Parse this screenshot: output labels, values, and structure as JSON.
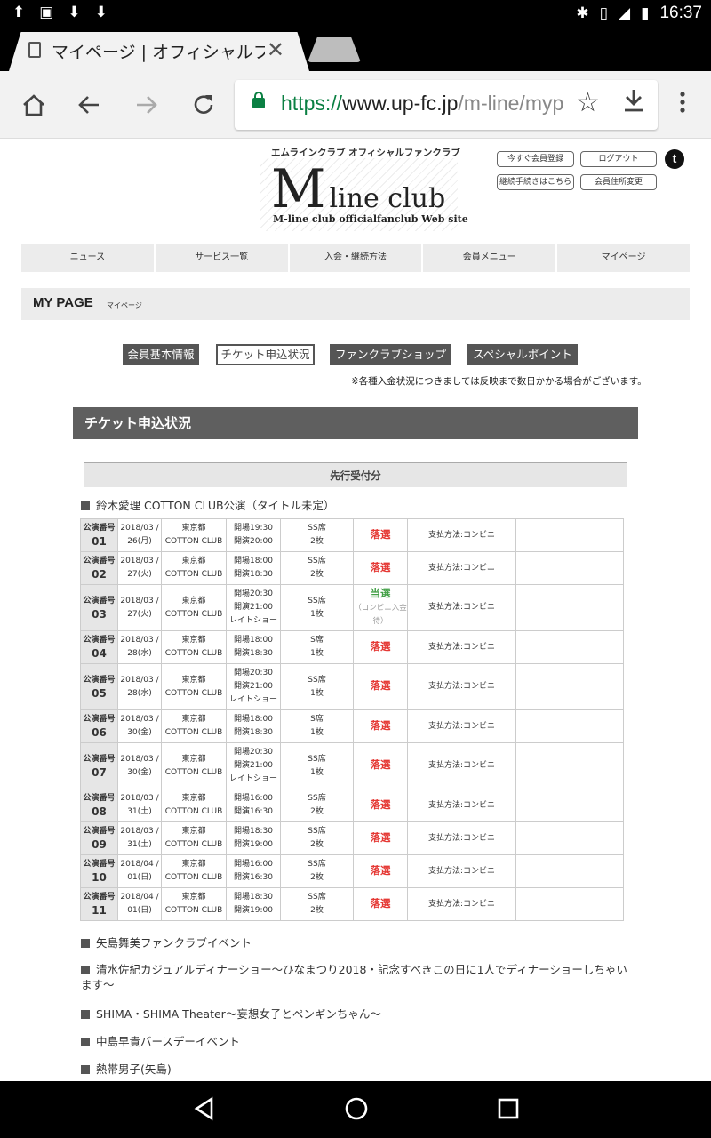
{
  "status_bar": {
    "time": "16:37"
  },
  "browser": {
    "tab_title": "マイページ | オフィシャルファ",
    "url_scheme": "https://",
    "url_host": "www.up-fc.jp",
    "url_path": "/m-line/mypa"
  },
  "header": {
    "logo_subtitle": "エムラインクラブ オフィシャルファンクラブ",
    "logo_big": "M",
    "logo_small": "line club",
    "logo_tagline": "M-line club officialfanclub Web site",
    "buttons": [
      "今すぐ会員登録",
      "ログアウト",
      "継続手続きはこちら",
      "会員住所変更"
    ],
    "twitter_glyph": "t"
  },
  "nav": [
    "ニュース",
    "サービス一覧",
    "入会・継続方法",
    "会員メニュー",
    "マイページ"
  ],
  "mypage": {
    "title_en": "MY PAGE",
    "title_jp": "マイページ"
  },
  "subnav": [
    "会員基本情報",
    "チケット申込状況",
    "ファンクラブショップ",
    "スペシャルポイント"
  ],
  "note": "※各種入金状況につきましては反映まで数日かかる場合がございます。",
  "section_title": "チケット申込状況",
  "phase_label": "先行受付分",
  "main_event": "鈴木愛理 COTTON CLUB公演（タイトル未定）",
  "rows": [
    {
      "label": "公演番号",
      "num": "01",
      "date1": "2018/03 /",
      "date2": "26(月)",
      "pref": "東京都",
      "venue": "COTTON CLUB",
      "open": "開場19:30",
      "start": "開演20:00",
      "extra": "",
      "seat": "SS席",
      "qty": "2枚",
      "result": "落選",
      "result_note": "",
      "pay": "支払方法:コンビニ"
    },
    {
      "label": "公演番号",
      "num": "02",
      "date1": "2018/03 /",
      "date2": "27(火)",
      "pref": "東京都",
      "venue": "COTTON CLUB",
      "open": "開場18:00",
      "start": "開演18:30",
      "extra": "",
      "seat": "SS席",
      "qty": "2枚",
      "result": "落選",
      "result_note": "",
      "pay": "支払方法:コンビニ"
    },
    {
      "label": "公演番号",
      "num": "03",
      "date1": "2018/03 /",
      "date2": "27(火)",
      "pref": "東京都",
      "venue": "COTTON CLUB",
      "open": "開場20:30",
      "start": "開演21:00",
      "extra": "レイトショー",
      "seat": "SS席",
      "qty": "1枚",
      "result": "当選",
      "result_note": "（コンビニ入金待）",
      "pay": "支払方法:コンビニ"
    },
    {
      "label": "公演番号",
      "num": "04",
      "date1": "2018/03 /",
      "date2": "28(水)",
      "pref": "東京都",
      "venue": "COTTON CLUB",
      "open": "開場18:00",
      "start": "開演18:30",
      "extra": "",
      "seat": "S席",
      "qty": "1枚",
      "result": "落選",
      "result_note": "",
      "pay": "支払方法:コンビニ"
    },
    {
      "label": "公演番号",
      "num": "05",
      "date1": "2018/03 /",
      "date2": "28(水)",
      "pref": "東京都",
      "venue": "COTTON CLUB",
      "open": "開場20:30",
      "start": "開演21:00",
      "extra": "レイトショー",
      "seat": "SS席",
      "qty": "1枚",
      "result": "落選",
      "result_note": "",
      "pay": "支払方法:コンビニ"
    },
    {
      "label": "公演番号",
      "num": "06",
      "date1": "2018/03 /",
      "date2": "30(金)",
      "pref": "東京都",
      "venue": "COTTON CLUB",
      "open": "開場18:00",
      "start": "開演18:30",
      "extra": "",
      "seat": "S席",
      "qty": "1枚",
      "result": "落選",
      "result_note": "",
      "pay": "支払方法:コンビニ"
    },
    {
      "label": "公演番号",
      "num": "07",
      "date1": "2018/03 /",
      "date2": "30(金)",
      "pref": "東京都",
      "venue": "COTTON CLUB",
      "open": "開場20:30",
      "start": "開演21:00",
      "extra": "レイトショー",
      "seat": "SS席",
      "qty": "1枚",
      "result": "落選",
      "result_note": "",
      "pay": "支払方法:コンビニ"
    },
    {
      "label": "公演番号",
      "num": "08",
      "date1": "2018/03 /",
      "date2": "31(土)",
      "pref": "東京都",
      "venue": "COTTON CLUB",
      "open": "開場16:00",
      "start": "開演16:30",
      "extra": "",
      "seat": "SS席",
      "qty": "2枚",
      "result": "落選",
      "result_note": "",
      "pay": "支払方法:コンビニ"
    },
    {
      "label": "公演番号",
      "num": "09",
      "date1": "2018/03 /",
      "date2": "31(土)",
      "pref": "東京都",
      "venue": "COTTON CLUB",
      "open": "開場18:30",
      "start": "開演19:00",
      "extra": "",
      "seat": "SS席",
      "qty": "2枚",
      "result": "落選",
      "result_note": "",
      "pay": "支払方法:コンビニ"
    },
    {
      "label": "公演番号",
      "num": "10",
      "date1": "2018/04 /",
      "date2": "01(日)",
      "pref": "東京都",
      "venue": "COTTON CLUB",
      "open": "開場16:00",
      "start": "開演16:30",
      "extra": "",
      "seat": "SS席",
      "qty": "2枚",
      "result": "落選",
      "result_note": "",
      "pay": "支払方法:コンビニ"
    },
    {
      "label": "公演番号",
      "num": "11",
      "date1": "2018/04 /",
      "date2": "01(日)",
      "pref": "東京都",
      "venue": "COTTON CLUB",
      "open": "開場18:30",
      "start": "開演19:00",
      "extra": "",
      "seat": "SS席",
      "qty": "2枚",
      "result": "落選",
      "result_note": "",
      "pay": "支払方法:コンビニ"
    }
  ],
  "other_events": [
    "矢島舞美ファンクラブイベント",
    "清水佐紀カジュアルディナーショー〜ひなまつり2018・記念すべきこの日に1人でディナーショーしちゃいます〜",
    "SHIMA・SHIMA Theater〜妄想女子とペンギンちゃん〜",
    "中島早貴バースデーイベント",
    "熱帯男子(矢島)"
  ]
}
